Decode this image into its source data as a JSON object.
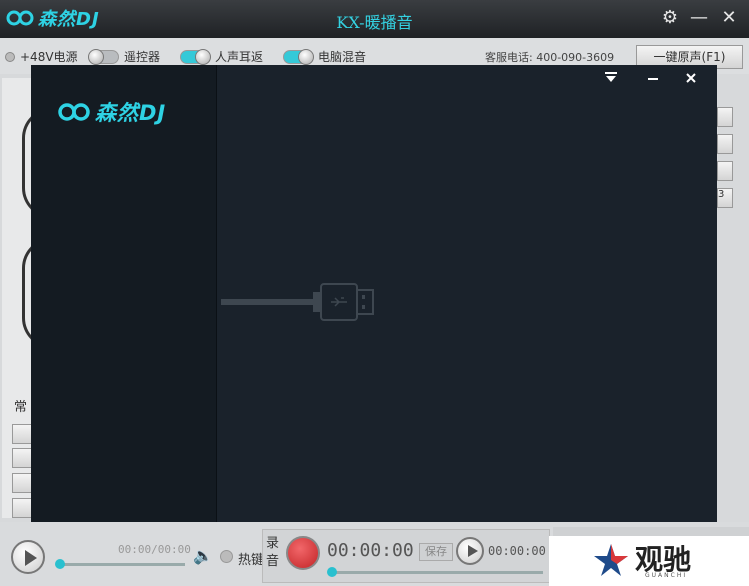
{
  "titlebar": {
    "logo_text": "森然DJ",
    "title": "KX-暖播音",
    "settings_icon": "gear-icon",
    "minimize_icon": "minimize-icon",
    "close_icon": "close-icon"
  },
  "toolbar": {
    "items": [
      {
        "label": "+48V电源",
        "state": "off"
      },
      {
        "label": "遥控器",
        "state": "off"
      },
      {
        "label": "人声耳返",
        "state": "on"
      },
      {
        "label": "电脑混音",
        "state": "on"
      }
    ],
    "phone": "客服电话: 400-090-3609",
    "onekey_button": "一键原声(F1)"
  },
  "left_panel": {
    "category_label": "常"
  },
  "dialog": {
    "logo_text": "森然DJ",
    "collapse_icon": "collapse-down-icon",
    "minimize_icon": "minimize-icon",
    "close_icon": "close-icon",
    "usb_icon": "usb-cable-icon"
  },
  "right_panel": {
    "button_label": "3"
  },
  "player": {
    "time": "00:00/00:00",
    "volume_icon": "speaker-icon",
    "hotkey_label": "热键"
  },
  "recorder": {
    "label": "录音",
    "time": "00:00:00",
    "save_button": "保存",
    "playback_time": "00:00:00"
  },
  "watermark": {
    "text": "观驰",
    "subtext": "GUANCHI"
  },
  "colors": {
    "accent": "#2ed2e4",
    "titlebar_bg": "#2b2e32",
    "dialog_bg": "#1a222b",
    "record_red": "#d8383a"
  }
}
